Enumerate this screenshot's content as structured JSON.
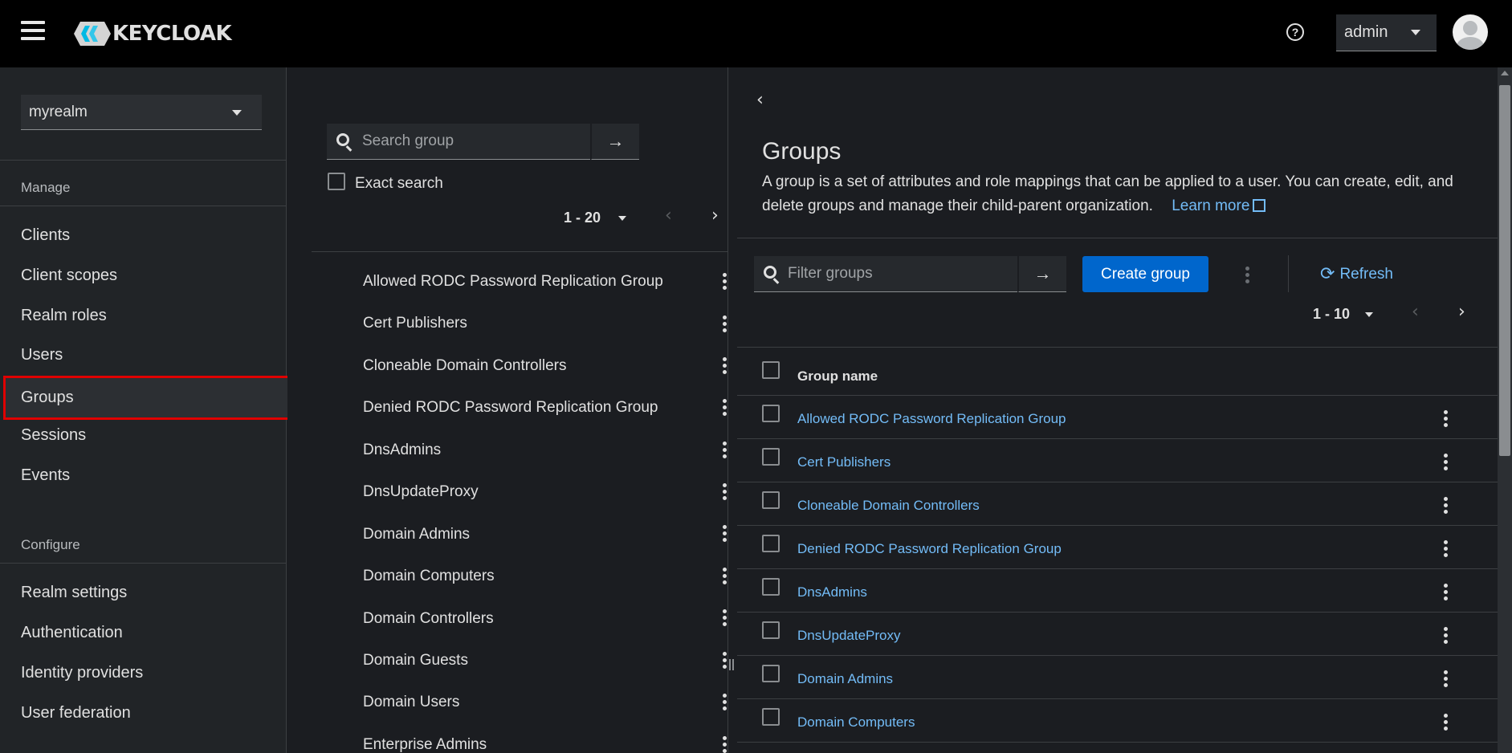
{
  "header": {
    "brand": "KEYCLOAK",
    "user": "admin",
    "icons": {
      "menu": "hamburger-icon",
      "help": "help-icon",
      "avatar": "avatar-icon"
    }
  },
  "sidebar": {
    "realm": "myrealm",
    "manage_title": "Manage",
    "manage_items": [
      "Clients",
      "Client scopes",
      "Realm roles",
      "Users",
      "Groups",
      "Sessions",
      "Events"
    ],
    "active_item": "Groups",
    "configure_title": "Configure",
    "configure_items": [
      "Realm settings",
      "Authentication",
      "Identity providers",
      "User federation"
    ]
  },
  "tree": {
    "search_placeholder": "Search group",
    "exact_search_label": "Exact search",
    "pagination": "1 - 20",
    "items": [
      "Allowed RODC Password Replication Group",
      "Cert Publishers",
      "Cloneable Domain Controllers",
      "Denied RODC Password Replication Group",
      "DnsAdmins",
      "DnsUpdateProxy",
      "Domain Admins",
      "Domain Computers",
      "Domain Controllers",
      "Domain Guests",
      "Domain Users",
      "Enterprise Admins"
    ]
  },
  "main": {
    "title": "Groups",
    "description": "A group is a set of attributes and role mappings that can be applied to a user. You can create, edit, and delete groups and manage their child-parent organization.",
    "learn_more": "Learn more",
    "filter_placeholder": "Filter groups",
    "create_button": "Create group",
    "refresh_label": "Refresh",
    "pagination": "1 - 10",
    "column_header": "Group name",
    "rows": [
      "Allowed RODC Password Replication Group",
      "Cert Publishers",
      "Cloneable Domain Controllers",
      "Denied RODC Password Replication Group",
      "DnsAdmins",
      "DnsUpdateProxy",
      "Domain Admins",
      "Domain Computers"
    ]
  },
  "colors": {
    "header_bg": "#000000",
    "sidebar_bg": "#212427",
    "content_bg": "#1b1d21",
    "link": "#73bcf7",
    "primary_button": "#0066cc",
    "highlight_border": "#e00000"
  }
}
